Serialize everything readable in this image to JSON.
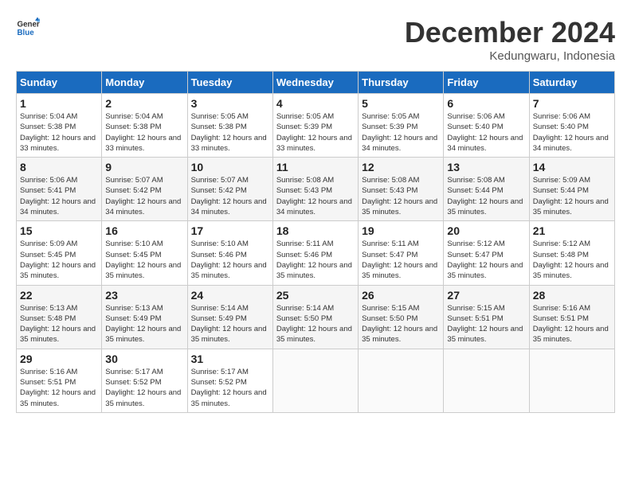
{
  "header": {
    "logo_line1": "General",
    "logo_line2": "Blue",
    "month": "December 2024",
    "location": "Kedungwaru, Indonesia"
  },
  "weekdays": [
    "Sunday",
    "Monday",
    "Tuesday",
    "Wednesday",
    "Thursday",
    "Friday",
    "Saturday"
  ],
  "weeks": [
    [
      {
        "day": "1",
        "sunrise": "5:04 AM",
        "sunset": "5:38 PM",
        "daylight": "12 hours and 33 minutes."
      },
      {
        "day": "2",
        "sunrise": "5:04 AM",
        "sunset": "5:38 PM",
        "daylight": "12 hours and 33 minutes."
      },
      {
        "day": "3",
        "sunrise": "5:05 AM",
        "sunset": "5:38 PM",
        "daylight": "12 hours and 33 minutes."
      },
      {
        "day": "4",
        "sunrise": "5:05 AM",
        "sunset": "5:39 PM",
        "daylight": "12 hours and 33 minutes."
      },
      {
        "day": "5",
        "sunrise": "5:05 AM",
        "sunset": "5:39 PM",
        "daylight": "12 hours and 34 minutes."
      },
      {
        "day": "6",
        "sunrise": "5:06 AM",
        "sunset": "5:40 PM",
        "daylight": "12 hours and 34 minutes."
      },
      {
        "day": "7",
        "sunrise": "5:06 AM",
        "sunset": "5:40 PM",
        "daylight": "12 hours and 34 minutes."
      }
    ],
    [
      {
        "day": "8",
        "sunrise": "5:06 AM",
        "sunset": "5:41 PM",
        "daylight": "12 hours and 34 minutes."
      },
      {
        "day": "9",
        "sunrise": "5:07 AM",
        "sunset": "5:42 PM",
        "daylight": "12 hours and 34 minutes."
      },
      {
        "day": "10",
        "sunrise": "5:07 AM",
        "sunset": "5:42 PM",
        "daylight": "12 hours and 34 minutes."
      },
      {
        "day": "11",
        "sunrise": "5:08 AM",
        "sunset": "5:43 PM",
        "daylight": "12 hours and 34 minutes."
      },
      {
        "day": "12",
        "sunrise": "5:08 AM",
        "sunset": "5:43 PM",
        "daylight": "12 hours and 35 minutes."
      },
      {
        "day": "13",
        "sunrise": "5:08 AM",
        "sunset": "5:44 PM",
        "daylight": "12 hours and 35 minutes."
      },
      {
        "day": "14",
        "sunrise": "5:09 AM",
        "sunset": "5:44 PM",
        "daylight": "12 hours and 35 minutes."
      }
    ],
    [
      {
        "day": "15",
        "sunrise": "5:09 AM",
        "sunset": "5:45 PM",
        "daylight": "12 hours and 35 minutes."
      },
      {
        "day": "16",
        "sunrise": "5:10 AM",
        "sunset": "5:45 PM",
        "daylight": "12 hours and 35 minutes."
      },
      {
        "day": "17",
        "sunrise": "5:10 AM",
        "sunset": "5:46 PM",
        "daylight": "12 hours and 35 minutes."
      },
      {
        "day": "18",
        "sunrise": "5:11 AM",
        "sunset": "5:46 PM",
        "daylight": "12 hours and 35 minutes."
      },
      {
        "day": "19",
        "sunrise": "5:11 AM",
        "sunset": "5:47 PM",
        "daylight": "12 hours and 35 minutes."
      },
      {
        "day": "20",
        "sunrise": "5:12 AM",
        "sunset": "5:47 PM",
        "daylight": "12 hours and 35 minutes."
      },
      {
        "day": "21",
        "sunrise": "5:12 AM",
        "sunset": "5:48 PM",
        "daylight": "12 hours and 35 minutes."
      }
    ],
    [
      {
        "day": "22",
        "sunrise": "5:13 AM",
        "sunset": "5:48 PM",
        "daylight": "12 hours and 35 minutes."
      },
      {
        "day": "23",
        "sunrise": "5:13 AM",
        "sunset": "5:49 PM",
        "daylight": "12 hours and 35 minutes."
      },
      {
        "day": "24",
        "sunrise": "5:14 AM",
        "sunset": "5:49 PM",
        "daylight": "12 hours and 35 minutes."
      },
      {
        "day": "25",
        "sunrise": "5:14 AM",
        "sunset": "5:50 PM",
        "daylight": "12 hours and 35 minutes."
      },
      {
        "day": "26",
        "sunrise": "5:15 AM",
        "sunset": "5:50 PM",
        "daylight": "12 hours and 35 minutes."
      },
      {
        "day": "27",
        "sunrise": "5:15 AM",
        "sunset": "5:51 PM",
        "daylight": "12 hours and 35 minutes."
      },
      {
        "day": "28",
        "sunrise": "5:16 AM",
        "sunset": "5:51 PM",
        "daylight": "12 hours and 35 minutes."
      }
    ],
    [
      {
        "day": "29",
        "sunrise": "5:16 AM",
        "sunset": "5:51 PM",
        "daylight": "12 hours and 35 minutes."
      },
      {
        "day": "30",
        "sunrise": "5:17 AM",
        "sunset": "5:52 PM",
        "daylight": "12 hours and 35 minutes."
      },
      {
        "day": "31",
        "sunrise": "5:17 AM",
        "sunset": "5:52 PM",
        "daylight": "12 hours and 35 minutes."
      },
      null,
      null,
      null,
      null
    ]
  ]
}
